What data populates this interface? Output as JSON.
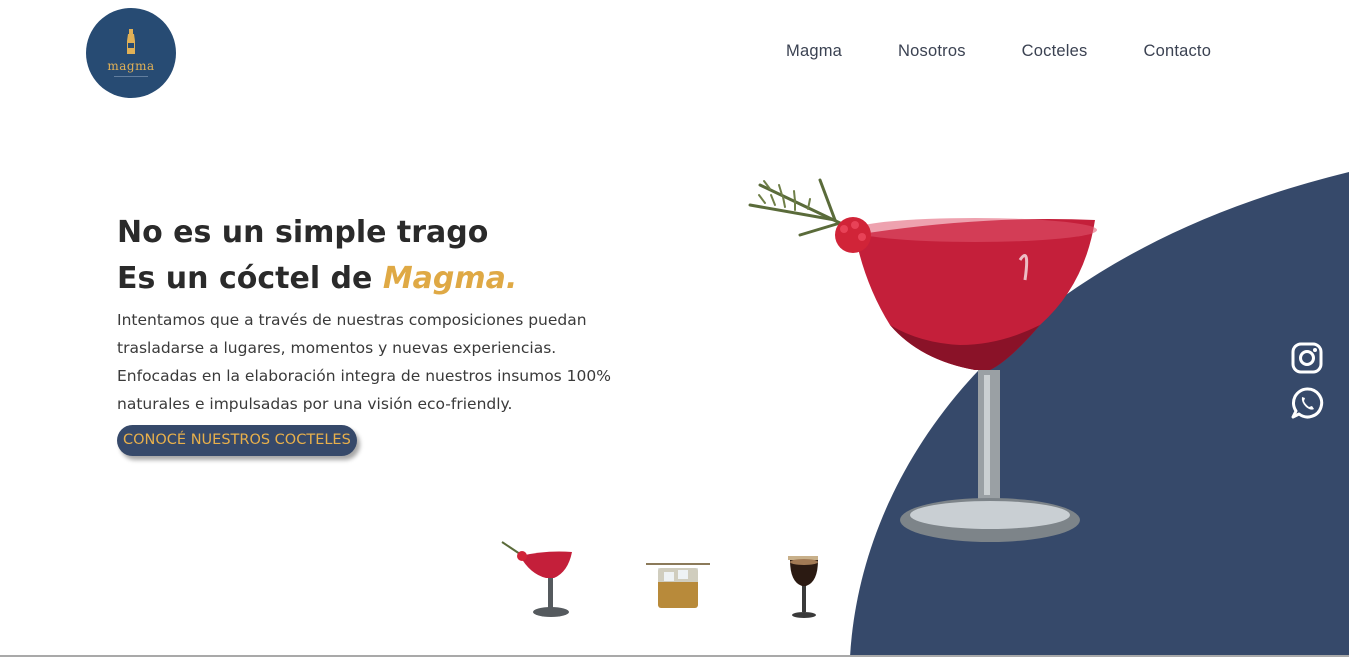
{
  "logo": {
    "text": "magma"
  },
  "nav": {
    "items": [
      "Magma",
      "Nosotros",
      "Cocteles",
      "Contacto"
    ]
  },
  "hero": {
    "title_line1": "No es un simple trago",
    "title_line2_prefix": "Es un cóctel de ",
    "title_line2_accent": "Magma.",
    "paragraph": "Intentamos que a través de nuestras composiciones puedan trasladarse a lugares, momentos y nuevas experiencias. Enfocadas en la elaboración integra de nuestros insumos 100% naturales e impulsadas por una visión eco-friendly.",
    "cta_label": "CONOCÉ NUESTROS COCTELES"
  },
  "colors": {
    "navy": "#36496a",
    "logo_bg": "#274b73",
    "accent_gold": "#dfa945"
  },
  "icons": [
    "instagram-icon",
    "whatsapp-icon"
  ]
}
